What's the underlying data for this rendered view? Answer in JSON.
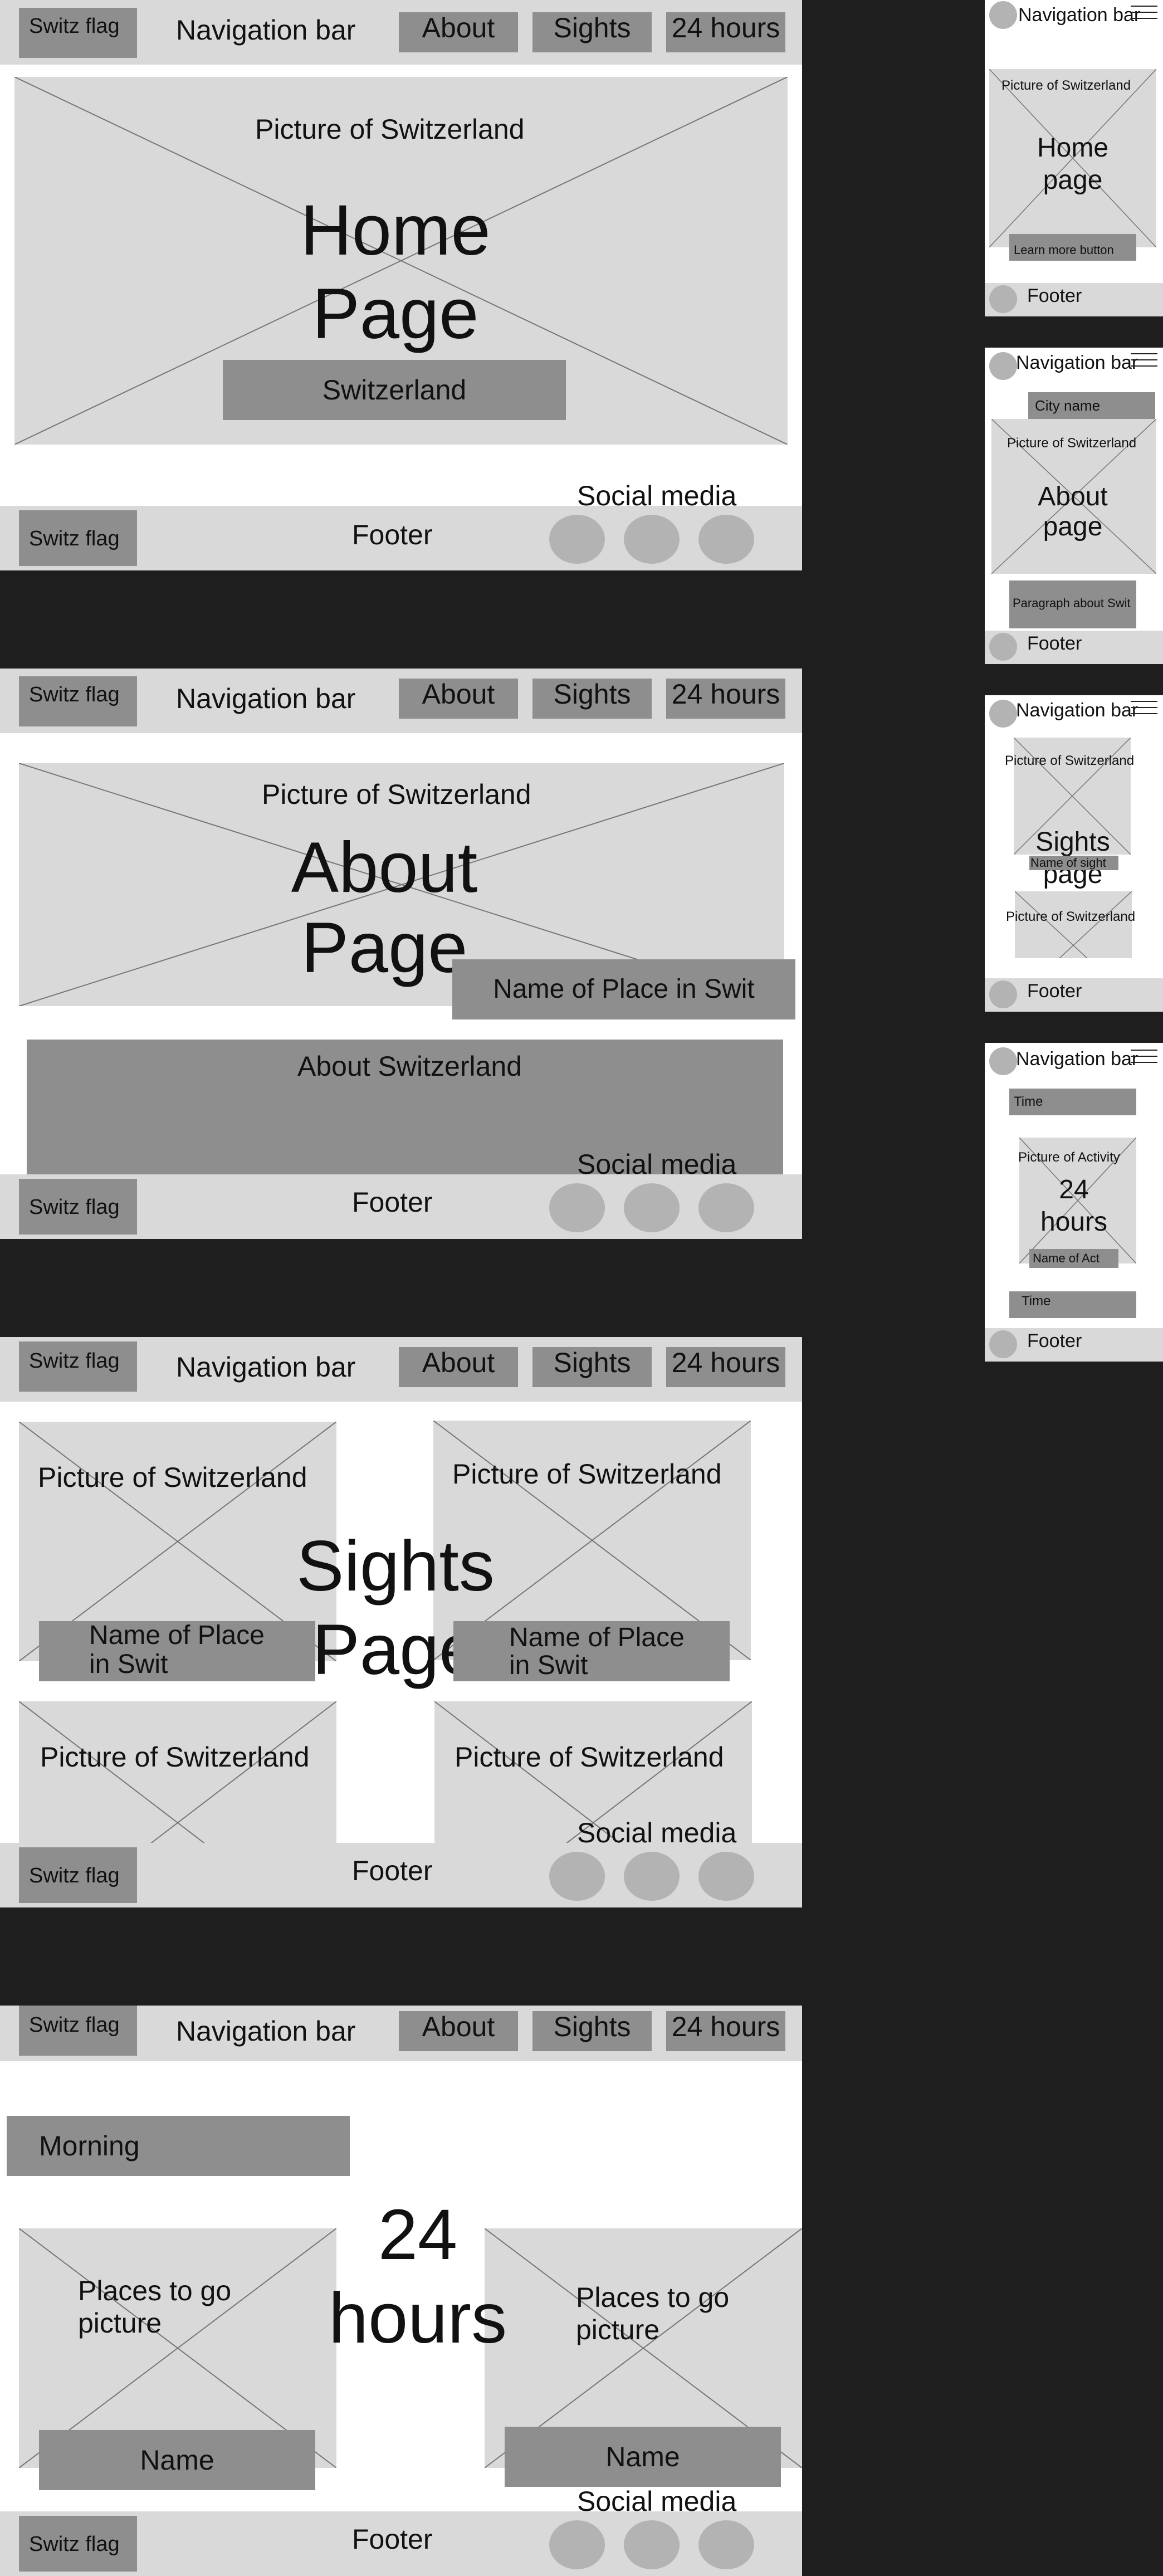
{
  "colors": {
    "canvas": "#1e1e1e",
    "frame": "#ffffff",
    "bar": "#d9d9d9",
    "placeholder": "#d9d9d9",
    "block": "#8e8e8e",
    "circle": "#b3b3b3"
  },
  "icons": [
    "image-placeholder-cross",
    "social-circle",
    "hamburger-menu-icon",
    "flag-circle"
  ],
  "desktop_common": {
    "flag": "Switz flag",
    "nav": "Navigation bar",
    "about": "About",
    "sights": "Sights",
    "hours": "24 hours",
    "footer": "Footer",
    "social": "Social media",
    "picture": "Picture of Switzerland"
  },
  "home": {
    "title_line1": "Home",
    "title_line2": "Page",
    "button": "Switzerland"
  },
  "about": {
    "title_line1": "About",
    "title_line2": "Page",
    "place": "Name of Place in Swit",
    "section": "About Switzerland"
  },
  "sights": {
    "title_line1": "Sights",
    "title_line2": "Page",
    "name_line1": "Name of Place",
    "name_line2": "in Swit"
  },
  "hours24": {
    "title_line1": "24",
    "title_line2": "hours",
    "morning": "Morning",
    "places_line1": "Places to go",
    "places_line2": "picture",
    "name": "Name"
  },
  "mobile": {
    "nav": "Navigation bar",
    "footer": "Footer",
    "home": {
      "picture": "Picture of Switzerland",
      "title_line1": "Home",
      "title_line2": "page",
      "button": "Learn more button"
    },
    "about": {
      "city": "City name",
      "picture": "Picture of Switzerland",
      "title_line1": "About",
      "title_line2": "page",
      "paragraph": "Paragraph about Swit"
    },
    "sights": {
      "picture": "Picture of Switzerland",
      "title_line1": "Sights",
      "title_line2": "page",
      "name": "Name of sight"
    },
    "hours24": {
      "time": "Time",
      "picture": "Picture of Activity",
      "title_line1": "24",
      "title_line2": "hours",
      "name": "Name of Act"
    }
  }
}
